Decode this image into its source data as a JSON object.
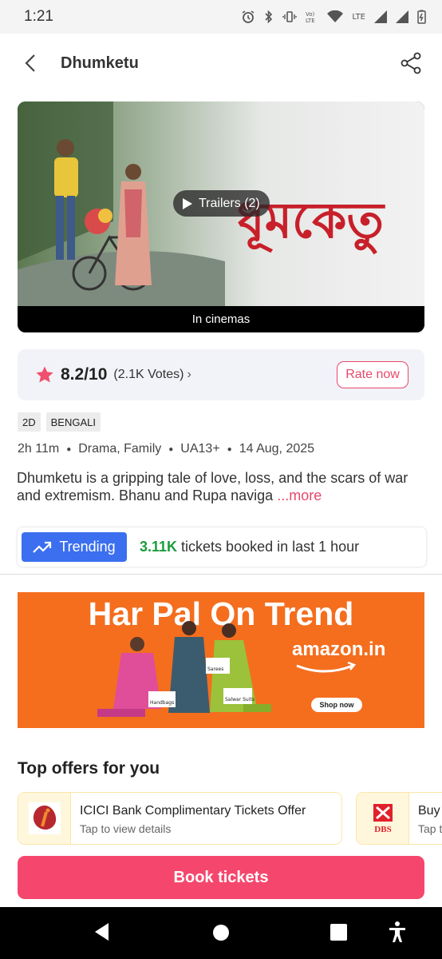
{
  "status_bar": {
    "time": "1:21",
    "network": "LTE"
  },
  "header": {
    "title": "Dhumketu"
  },
  "banner": {
    "title_art": "ধূমকেতু",
    "trailers_label": "Trailers (2)",
    "release_status": "In cinemas"
  },
  "rating": {
    "score": "8.2/10",
    "votes": "(2.1K Votes)",
    "rate_label": "Rate now",
    "star_color": "#f0506e"
  },
  "tags": [
    "2D",
    "BENGALI"
  ],
  "meta": {
    "duration": "2h 11m",
    "genres": "Drama, Family",
    "certificate": "UA13+",
    "release_date": "14 Aug, 2025"
  },
  "description": {
    "text": "Dhumketu is a gripping tale of love, loss, and the scars of war and extremism. Bhanu and Rupa naviga",
    "more_label": " ...more"
  },
  "trending": {
    "badge_label": "Trending",
    "count": "3.11K",
    "text": " tickets booked in last 1 hour"
  },
  "ad": {
    "headline": "Har Pal On Trend",
    "brand": "amazon.in",
    "cta": "Shop now",
    "labels": [
      "Handbags",
      "Sarees",
      "Salwar Suits"
    ]
  },
  "offers": {
    "title": "Top offers for you",
    "items": [
      {
        "title": "ICICI Bank Complimentary Tickets Offer",
        "subtitle": "Tap to view details",
        "bank": "ICICI"
      },
      {
        "title": "Buy",
        "subtitle": "Tap t",
        "bank": "DBS"
      }
    ]
  },
  "cta": {
    "book_label": "Book tickets"
  },
  "colors": {
    "brand": "#f5476d",
    "trend_blue": "#3b6ff0",
    "trend_green": "#1a9d3c",
    "ad_orange": "#f46e1e"
  }
}
